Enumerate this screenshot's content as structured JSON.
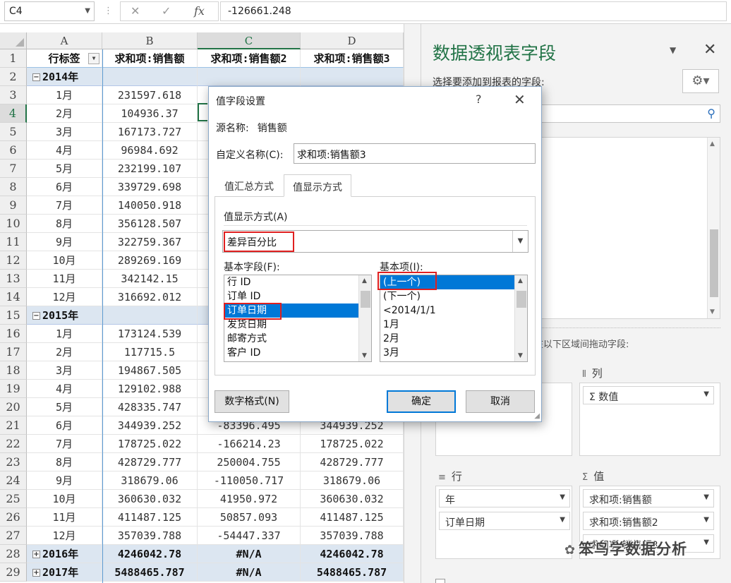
{
  "formula_bar": {
    "name_box": "C4",
    "cancel_icon": "✕",
    "enter_icon": "✓",
    "fx_label": "fx",
    "formula": "-126661.248"
  },
  "sheet": {
    "columns": [
      "A",
      "B",
      "C",
      "D"
    ],
    "rows": [
      {
        "n": "1",
        "type": "header",
        "a": "行标签",
        "b": "求和项:销售额",
        "c": "求和项:销售额2",
        "d": "求和项:销售额3"
      },
      {
        "n": "2",
        "type": "year",
        "sign": "−",
        "a": "2014年",
        "b": "",
        "c": "",
        "d": ""
      },
      {
        "n": "3",
        "type": "data",
        "a": "1月",
        "b": "231597.618",
        "c": "",
        "d": ""
      },
      {
        "n": "4",
        "type": "data",
        "a": "2月",
        "b": "104936.37",
        "c": "",
        "d": ""
      },
      {
        "n": "5",
        "type": "data",
        "a": "3月",
        "b": "167173.727",
        "c": "",
        "d": ""
      },
      {
        "n": "6",
        "type": "data",
        "a": "4月",
        "b": "96984.692",
        "c": "",
        "d": ""
      },
      {
        "n": "7",
        "type": "data",
        "a": "5月",
        "b": "232199.107",
        "c": "",
        "d": ""
      },
      {
        "n": "8",
        "type": "data",
        "a": "6月",
        "b": "339729.698",
        "c": "",
        "d": ""
      },
      {
        "n": "9",
        "type": "data",
        "a": "7月",
        "b": "140050.918",
        "c": "",
        "d": ""
      },
      {
        "n": "10",
        "type": "data",
        "a": "8月",
        "b": "356128.507",
        "c": "",
        "d": ""
      },
      {
        "n": "11",
        "type": "data",
        "a": "9月",
        "b": "322759.367",
        "c": "",
        "d": ""
      },
      {
        "n": "12",
        "type": "data",
        "a": "10月",
        "b": "289269.169",
        "c": "",
        "d": ""
      },
      {
        "n": "13",
        "type": "data",
        "a": "11月",
        "b": "342142.15",
        "c": "",
        "d": ""
      },
      {
        "n": "14",
        "type": "data",
        "a": "12月",
        "b": "316692.012",
        "c": "",
        "d": ""
      },
      {
        "n": "15",
        "type": "year",
        "sign": "−",
        "a": "2015年",
        "b": "",
        "c": "",
        "d": ""
      },
      {
        "n": "16",
        "type": "data",
        "a": "1月",
        "b": "173124.539",
        "c": "",
        "d": ""
      },
      {
        "n": "17",
        "type": "data",
        "a": "2月",
        "b": "117715.5",
        "c": "",
        "d": ""
      },
      {
        "n": "18",
        "type": "data",
        "a": "3月",
        "b": "194867.505",
        "c": "",
        "d": ""
      },
      {
        "n": "19",
        "type": "data",
        "a": "4月",
        "b": "129102.988",
        "c": "",
        "d": ""
      },
      {
        "n": "20",
        "type": "data",
        "a": "5月",
        "b": "428335.747",
        "c": "",
        "d": ""
      },
      {
        "n": "21",
        "type": "data",
        "a": "6月",
        "b": "344939.252",
        "c": "-83396.495",
        "d": "344939.252"
      },
      {
        "n": "22",
        "type": "data",
        "a": "7月",
        "b": "178725.022",
        "c": "-166214.23",
        "d": "178725.022"
      },
      {
        "n": "23",
        "type": "data",
        "a": "8月",
        "b": "428729.777",
        "c": "250004.755",
        "d": "428729.777"
      },
      {
        "n": "24",
        "type": "data",
        "a": "9月",
        "b": "318679.06",
        "c": "-110050.717",
        "d": "318679.06"
      },
      {
        "n": "25",
        "type": "data",
        "a": "10月",
        "b": "360630.032",
        "c": "41950.972",
        "d": "360630.032"
      },
      {
        "n": "26",
        "type": "data",
        "a": "11月",
        "b": "411487.125",
        "c": "50857.093",
        "d": "411487.125"
      },
      {
        "n": "27",
        "type": "data",
        "a": "12月",
        "b": "357039.788",
        "c": "-54447.337",
        "d": "357039.788"
      },
      {
        "n": "28",
        "type": "yeartot",
        "sign": "+",
        "a": "2016年",
        "b": "4246042.78",
        "c": "#N/A",
        "d": "4246042.78"
      },
      {
        "n": "29",
        "type": "yeartot",
        "sign": "+",
        "a": "2017年",
        "b": "5488465.787",
        "c": "#N/A",
        "d": "5488465.787"
      }
    ]
  },
  "pane": {
    "title": "数据透视表字段",
    "subtitle": "选择要添加到报表的字段:",
    "drag_hint": "在以下区域间拖动字段:",
    "columns_label": "列",
    "rows_label": "行",
    "values_label": "值",
    "column_items": [
      "Σ 数值"
    ],
    "row_items": [
      "年",
      "订单日期"
    ],
    "value_items": [
      "求和项:销售额",
      "求和项:销售额2",
      "求和项:销售额3"
    ]
  },
  "dialog": {
    "title": "值字段设置",
    "help": "?",
    "close": "✕",
    "source_label": "源名称:",
    "source_value": "销售额",
    "custom_name_label": "自定义名称(C):",
    "custom_name_value": "求和项:销售额3",
    "tabs": [
      "值汇总方式",
      "值显示方式"
    ],
    "show_as_label": "值显示方式(A)",
    "show_as_value": "差异百分比",
    "base_field_label": "基本字段(F):",
    "base_fields": [
      "行 ID",
      "订单 ID",
      "订单日期",
      "发货日期",
      "邮寄方式",
      "客户 ID"
    ],
    "base_item_label": "基本项(I):",
    "base_items": [
      "(上一个)",
      "(下一个)",
      "<2014/1/1",
      "1月",
      "2月",
      "3月"
    ],
    "number_format_button": "数字格式(N)",
    "ok_button": "确定",
    "cancel_button": "取消"
  },
  "watermark": "笨鸟学数据分析"
}
